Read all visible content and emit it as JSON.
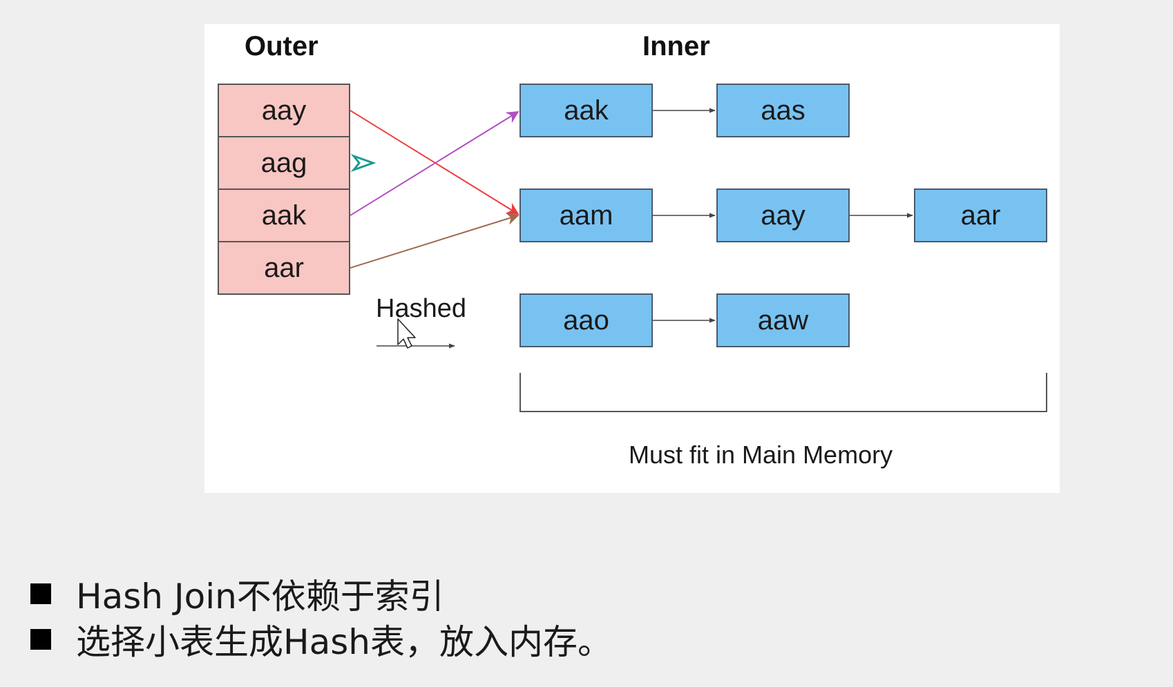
{
  "diagram": {
    "outer_title": "Outer",
    "inner_title": "Inner",
    "outer_keys": [
      "aay",
      "aag",
      "aak",
      "aar"
    ],
    "buckets": [
      [
        "aak",
        "aas"
      ],
      [
        "aam",
        "aay",
        "aar"
      ],
      [
        "aao",
        "aaw"
      ]
    ],
    "hashed_label": "Hashed",
    "memory_label": "Must fit in Main Memory",
    "colors": {
      "outer_fill": "#f8c6c3",
      "inner_fill": "#78c2f2",
      "arrow_aay": "#ef3b3b",
      "arrow_aag": "#1a9a93",
      "arrow_aak": "#b04fc0",
      "arrow_aar": "#a06a50"
    }
  },
  "bullets": [
    "Hash Join不依赖于索引",
    "选择小表生成Hash表，放入内存。"
  ]
}
